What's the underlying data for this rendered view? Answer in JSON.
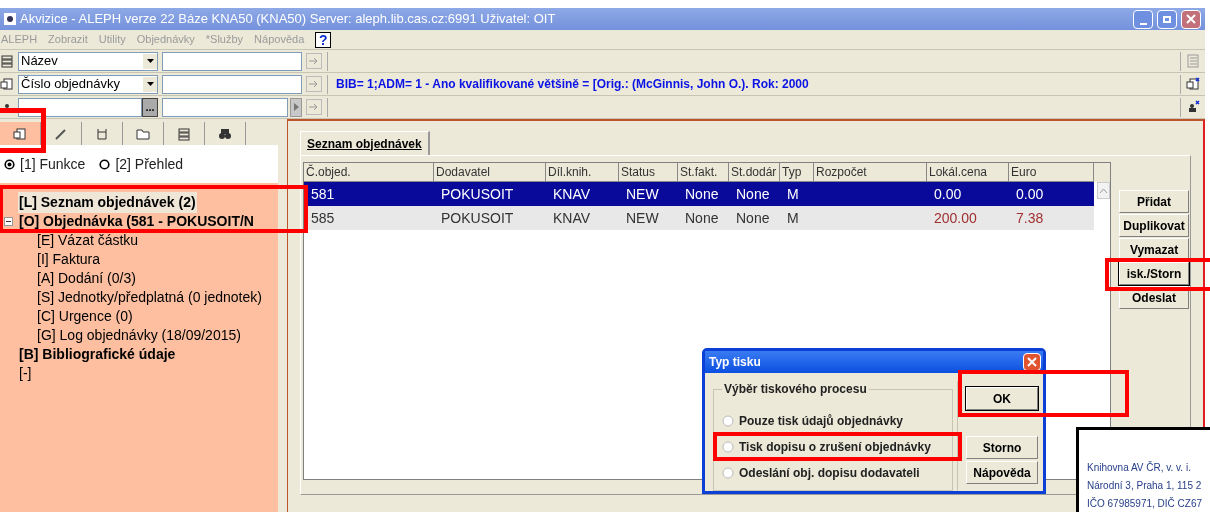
{
  "window": {
    "title": "Akvizice - ALEPH verze 22  Báze KNA50 (KNA50)  Server: aleph.lib.cas.cz:6991  Uživatel: OIT"
  },
  "menu": [
    {
      "label": "ALEPH",
      "disabled": true
    },
    {
      "label": "Zobrazit",
      "disabled": true
    },
    {
      "label": "Utility",
      "disabled": true
    },
    {
      "label": "Objednávky",
      "disabled": true
    },
    {
      "label": "*Služby",
      "disabled": true
    },
    {
      "label": "Nápověda",
      "disabled": true
    }
  ],
  "help_button": "?",
  "search_rows": [
    {
      "kind": "dropdown",
      "field": "Název"
    },
    {
      "kind": "dropdown",
      "field": "Číslo objednávky",
      "result": "BIB= 1;ADM= 1 - Ano kvalifikované většině = [Orig.: (McGinnis, John O.). Rok: 2000"
    },
    {
      "kind": "lookup",
      "button": "..."
    }
  ],
  "left_tabs": [
    {
      "selected": true
    },
    {
      "selected": false
    },
    {
      "selected": false
    },
    {
      "selected": false
    },
    {
      "selected": false
    },
    {
      "selected": false
    }
  ],
  "view_options": [
    {
      "label": "[1] Funkce",
      "selected": true
    },
    {
      "label": "[2] Přehled",
      "selected": false
    }
  ],
  "tree": [
    {
      "label": "[L] Seznam objednávek (2)",
      "bold": true,
      "selected": true
    },
    {
      "label": "[O] Objednávka (581 - POKUSOIT/N",
      "bold": true,
      "selected": false,
      "expanded": true,
      "children": [
        {
          "label": "[E] Vázat částku",
          "bold": false,
          "selected": false
        },
        {
          "label": "[I] Faktura",
          "bold": false,
          "selected": false
        },
        {
          "label": "[A] Dodání (0/3)",
          "bold": false,
          "selected": false
        },
        {
          "label": "[S] Jednotky/předplatná (0 jednotek)",
          "bold": false,
          "selected": false
        },
        {
          "label": "[C] Urgence (0)",
          "bold": false,
          "selected": false
        },
        {
          "label": "[G] Log objednávky (18/09/2015)",
          "bold": false,
          "selected": false
        }
      ]
    },
    {
      "label": "[B] Bibliografické údaje",
      "bold": true,
      "selected": false
    },
    {
      "label": "[-]",
      "bold": false,
      "selected": false
    }
  ],
  "tabs": [
    {
      "label": "Seznam objednávek",
      "selected": true
    }
  ],
  "table": {
    "columns": [
      "Č.objed.",
      "Dodavatel",
      "Díl.knih.",
      "Status",
      "St.fakt.",
      "St.dodár",
      "Typ",
      "Rozpočet",
      "Lokál.cena",
      "Euro"
    ],
    "rows": [
      {
        "selected": true,
        "cells": [
          "581",
          "POKUSOIT",
          "KNAV",
          "NEW",
          "None",
          "None",
          "M",
          "",
          "0.00",
          "0.00"
        ]
      },
      {
        "selected": false,
        "cells": [
          "585",
          "POKUSOIT",
          "KNAV",
          "NEW",
          "None",
          "None",
          "M",
          "",
          "200.00",
          "7.38"
        ]
      }
    ]
  },
  "actions": [
    "Přidat",
    "Duplikovat",
    "Vymazat",
    "isk./Storn",
    "Odeslat"
  ],
  "dialog": {
    "title": "Typ tisku",
    "group": "Výběr tiskového procesu",
    "options": [
      {
        "label": "Pouze tisk údajů objednávky",
        "selected": false
      },
      {
        "label": "Tisk dopisu o zrušení objednávky",
        "selected": false
      },
      {
        "label": "Odeslání obj. dopisu dodavateli",
        "selected": false
      }
    ],
    "buttons": [
      "OK",
      "Storno",
      "Nápověda"
    ]
  },
  "letterhead": [
    "Knihovna AV ČR, v. v. i.",
    "Národní 3, Praha 1, 115 2",
    "IČO 67985971, DIČ CZ67"
  ]
}
